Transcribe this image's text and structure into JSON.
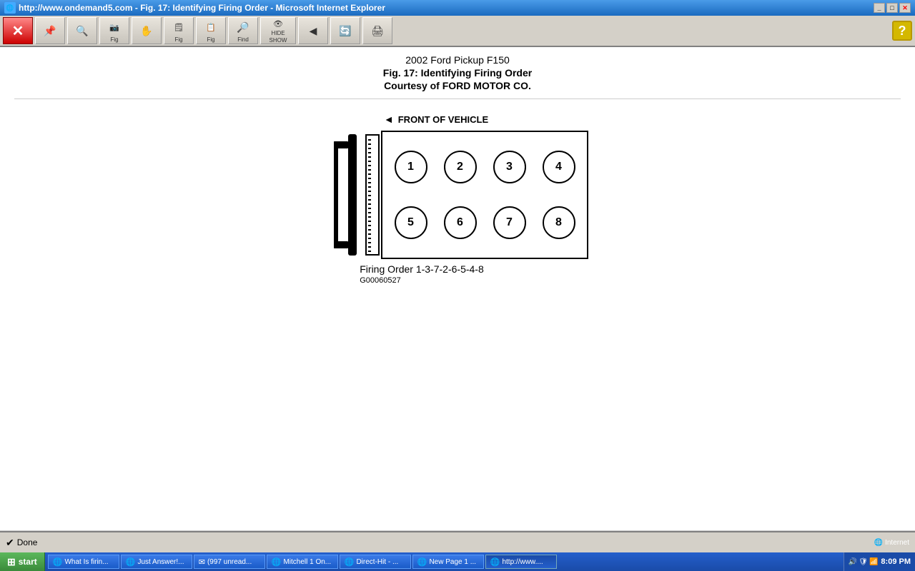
{
  "window": {
    "title": "http://www.ondemand5.com - Fig. 17: Identifying Firing Order - Microsoft Internet Explorer",
    "title_icon": "🌐"
  },
  "toolbar": {
    "buttons": [
      {
        "id": "close",
        "icon": "✕",
        "color": "red",
        "label": ""
      },
      {
        "id": "back",
        "icon": "🔍",
        "label": ""
      },
      {
        "id": "forward",
        "icon": "🔍",
        "label": ""
      },
      {
        "id": "fig",
        "icon": "📄",
        "label": "Fig"
      },
      {
        "id": "hand",
        "icon": "✋",
        "label": ""
      },
      {
        "id": "fig2",
        "icon": "📄",
        "label": "Fig"
      },
      {
        "id": "fig3",
        "icon": "📄",
        "label": "Fig"
      },
      {
        "id": "find",
        "icon": "🔍",
        "label": "Find"
      },
      {
        "id": "hideshow",
        "icon": "👁",
        "label": "HIDE\nSHOW"
      },
      {
        "id": "refresh",
        "icon": "🔄",
        "label": ""
      },
      {
        "id": "reload",
        "icon": "🔄",
        "label": ""
      },
      {
        "id": "print",
        "icon": "🖨",
        "label": ""
      }
    ],
    "help_label": "?"
  },
  "page": {
    "title1": "2002 Ford Pickup F150",
    "title2": "Fig. 17: Identifying Firing Order",
    "title3": "Courtesy of FORD MOTOR CO."
  },
  "diagram": {
    "front_label": "FRONT OF VEHICLE",
    "cylinders": [
      "①",
      "②",
      "③",
      "④",
      "⑤",
      "⑥",
      "⑦",
      "⑧"
    ],
    "cylinder_numbers": [
      "1",
      "2",
      "3",
      "4",
      "5",
      "6",
      "7",
      "8"
    ],
    "firing_order_label": "Firing Order 1-3-7-2-6-5-4-8",
    "part_number": "G00060527"
  },
  "status_bar": {
    "status_text": "Done",
    "zone_text": "Internet"
  },
  "taskbar": {
    "time": "8:09 PM",
    "start_label": "start",
    "items": [
      {
        "label": "What Is firin...",
        "icon": "🌐",
        "active": false
      },
      {
        "label": "Just Answer!...",
        "icon": "🌐",
        "active": false
      },
      {
        "label": "(997 unread...",
        "icon": "🌐",
        "active": false
      },
      {
        "label": "Mitchell 1 On...",
        "icon": "🌐",
        "active": false
      },
      {
        "label": "Direct-Hit - ...",
        "icon": "🌐",
        "active": false
      },
      {
        "label": "New Page 1 ...",
        "icon": "🌐",
        "active": false
      },
      {
        "label": "http://www....",
        "icon": "🌐",
        "active": true
      }
    ]
  }
}
